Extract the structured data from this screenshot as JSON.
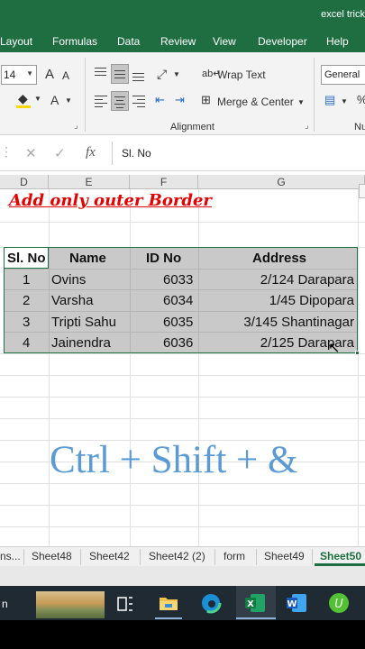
{
  "title": "excel trick",
  "menu": [
    "Layout",
    "Formulas",
    "Data",
    "Review",
    "View",
    "Developer",
    "Help"
  ],
  "ribbon": {
    "font_size": "14",
    "grow_font": "A",
    "shrink_font": "A",
    "wrap_text": "Wrap Text",
    "merge_center": "Merge & Center",
    "alignment_label": "Alignment",
    "number_format": "General",
    "number_label": "Nu"
  },
  "formula_bar": {
    "fx": "fx",
    "content": "Sl. No"
  },
  "columns": [
    "D",
    "E",
    "F",
    "G"
  ],
  "heading": "Add only outer Border",
  "table": {
    "headers": [
      "Sl. No",
      "Name",
      "ID No",
      "Address"
    ],
    "rows": [
      [
        "1",
        "Ovins",
        "6033",
        "2/124 Darapara"
      ],
      [
        "2",
        "Varsha",
        "6034",
        "1/45 Dipopara"
      ],
      [
        "3",
        "Tripti Sahu",
        "6035",
        "3/145 Shantinagar"
      ],
      [
        "4",
        "Jainendra",
        "6036",
        "2/125 Darapara"
      ]
    ]
  },
  "shortcut": "Ctrl + Shift + &",
  "sheet_tabs": [
    "ns...",
    "Sheet48",
    "Sheet42",
    "Sheet42 (2)",
    "form",
    "Sheet49",
    "Sheet50"
  ],
  "taskbar_text": "n",
  "colors": {
    "excel_green": "#1e6e42",
    "heading_red": "#e60000",
    "shortcut_blue": "#5b9bd5"
  }
}
